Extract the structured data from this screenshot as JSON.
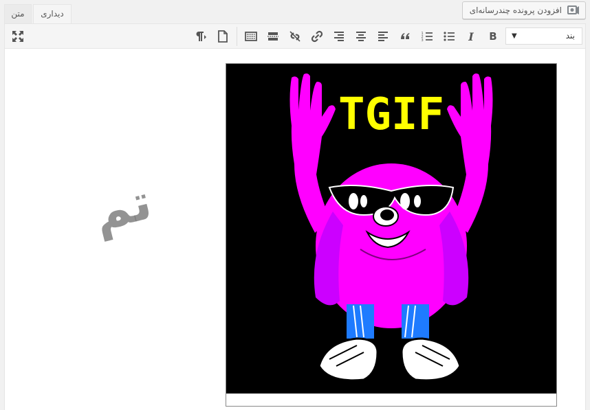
{
  "tabs": {
    "text": "متن",
    "visual": "دیداری"
  },
  "media_button": {
    "label": "افزودن پرونده چندرسانه‌ای",
    "icon": "add-media-icon"
  },
  "toolbar": {
    "format_select": {
      "value": "بند",
      "arrow": "▼"
    },
    "bold_label": "B",
    "italic_label": "I",
    "buttons": [
      "bold",
      "italic",
      "bulleted-list",
      "numbered-list",
      "blockquote",
      "align-left",
      "align-center",
      "align-right",
      "insert-link",
      "remove-link",
      "read-more",
      "toolbar-toggle",
      "paste-as-text",
      "paragraph-mark",
      "fullscreen"
    ]
  },
  "content": {
    "image": {
      "headline": "TGIF"
    },
    "watermark": "تم"
  },
  "colors": {
    "editor_bg": "#ffffff",
    "toolbar_bg": "#f5f5f5",
    "character_magenta": "#ff00ff",
    "headline_yellow": "#ffff00",
    "image_bg": "#000000"
  }
}
